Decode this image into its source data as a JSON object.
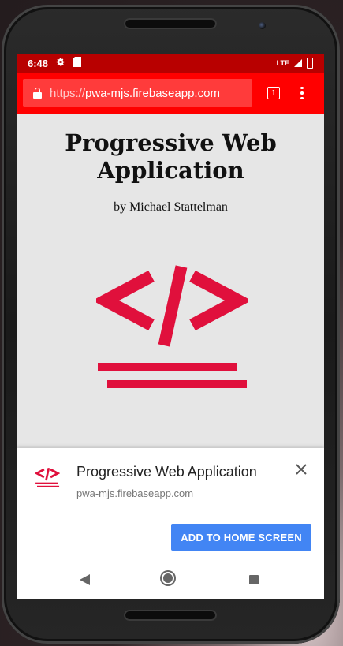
{
  "status_bar": {
    "time": "6:48",
    "settings_icon": "gear-icon",
    "sd_icon": "sd-card-icon",
    "network_label": "LTE",
    "signal_icon": "signal-icon",
    "battery_icon": "battery-icon"
  },
  "toolbar": {
    "url_scheme": "https://",
    "url_host": "pwa-mjs.firebaseapp.com",
    "tab_count": "1",
    "lock_icon": "lock-icon",
    "menu_icon": "more-vert-icon"
  },
  "page": {
    "title": "Progressive Web Application",
    "byline": "by Michael Stattelman",
    "logo_icon": "code-tag-icon"
  },
  "install_banner": {
    "app_name": "Progressive Web Application",
    "app_url": "pwa-mjs.firebaseapp.com",
    "button_label": "ADD TO HOME SCREEN",
    "close_icon": "close-icon",
    "logo_icon": "code-tag-icon"
  },
  "navbar": {
    "back_icon": "back-icon",
    "home_icon": "home-icon",
    "recents_icon": "recents-icon"
  },
  "colors": {
    "status_bar": "#b80000",
    "toolbar": "#ff0000",
    "brand_red": "#e0103c",
    "button_blue": "#4285f4"
  }
}
